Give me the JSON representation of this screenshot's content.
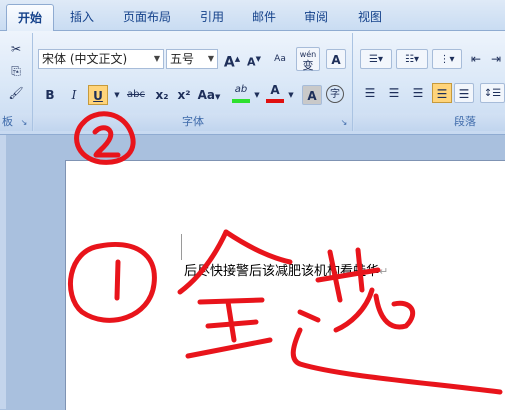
{
  "tabs": [
    "开始",
    "插入",
    "页面布局",
    "引用",
    "邮件",
    "审阅",
    "视图"
  ],
  "font": {
    "name": "宋体 (中文正文)",
    "size": "五号",
    "group_label": "字体",
    "grow_label": "A",
    "shrink_label": "A",
    "clear_label": "Aa",
    "phonetic_label": "wén",
    "phonetic_char": "变",
    "border_label": "A",
    "bold": "B",
    "italic": "I",
    "underline": "U",
    "strike": "abc",
    "subscript": "x₂",
    "superscript": "x²",
    "case": "Aa",
    "highlight": "ab",
    "color": "A",
    "shade": "A",
    "enclose": "字"
  },
  "paragraph": {
    "group_label": "段落"
  },
  "clipboard": {
    "group_label": "板"
  },
  "document": {
    "text": "后尽快接警后该减肥该机构看蛙华",
    "return_mark": "↵"
  },
  "colors": {
    "ink": "#e8141b",
    "highlight": "#2ee02e",
    "font_color": "#e01010"
  }
}
